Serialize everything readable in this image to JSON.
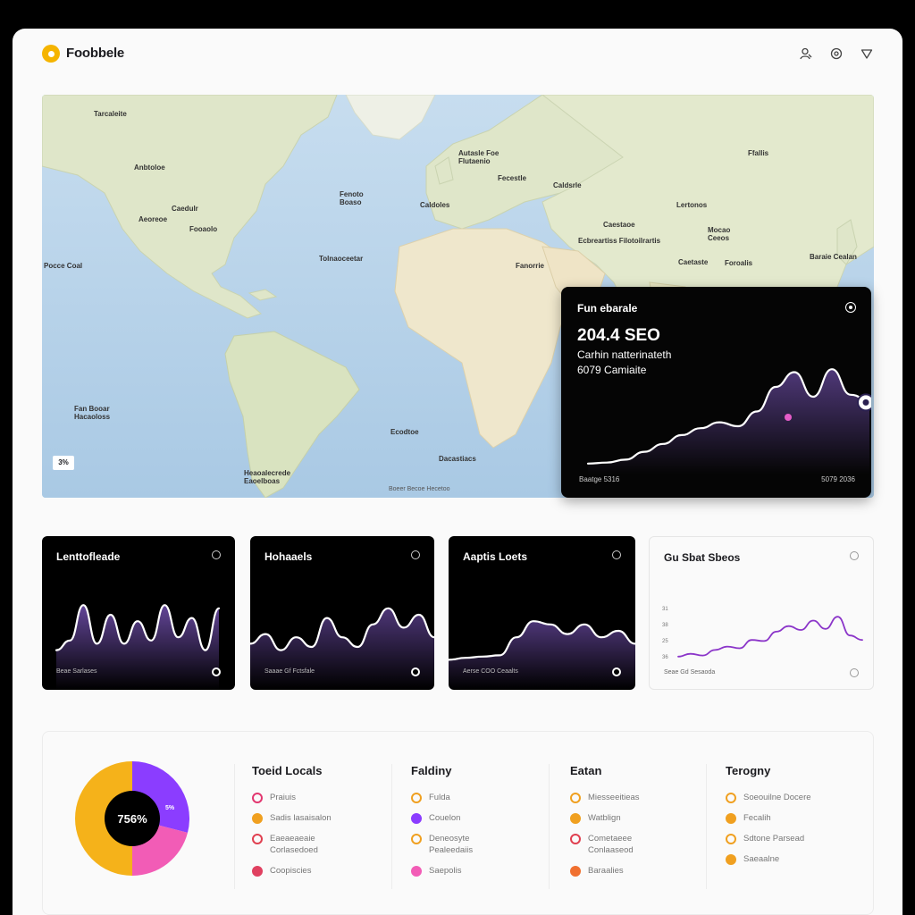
{
  "app": {
    "title": "Foobbele"
  },
  "header_icons": [
    "user-icon",
    "settings-icon",
    "heart-icon"
  ],
  "map": {
    "labels": [
      {
        "text": "Tarcaleite"
      },
      {
        "text": "Anbtoloe"
      },
      {
        "text": "Caedulr"
      },
      {
        "text": "Fooaolo"
      },
      {
        "text": "Pocce Coal"
      },
      {
        "text": "Aeoreoe"
      },
      {
        "text": "Tolnaoceetar"
      },
      {
        "text": "Fenoto Boaso"
      },
      {
        "text": "Caldoles"
      },
      {
        "text": "Autasle Foe Flutaenio"
      },
      {
        "text": "Fecestle"
      },
      {
        "text": "Caldsrle"
      },
      {
        "text": "Ffallis"
      },
      {
        "text": "Lertonos"
      },
      {
        "text": "Caestaoe"
      },
      {
        "text": "Ecbreartiss Filotoilrartis"
      },
      {
        "text": "Mocao Ceeos"
      },
      {
        "text": "Fanorrie"
      },
      {
        "text": "Caetaste"
      },
      {
        "text": "Foroalis"
      },
      {
        "text": "Ecodtoe"
      },
      {
        "text": "Baraie Cealan"
      },
      {
        "text": "Fan Booar Hacaoloss"
      },
      {
        "text": "Dacastiacs"
      },
      {
        "text": "Heaoalecrede Eaoelboas"
      }
    ],
    "scale_label": "3%",
    "attribution": "Boeer Becoe Hecetoo"
  },
  "popup": {
    "title": "Fun ebarale",
    "value": "204.4 SEO",
    "sub1": "Carhin natterinateth",
    "sub2": "6079 Camiaite",
    "foot_left": "Baatge 5316",
    "foot_right": "5079 2036",
    "series": [
      2,
      3,
      6,
      14,
      22,
      31,
      38,
      44,
      40,
      55,
      80,
      95,
      70,
      98,
      72,
      66
    ]
  },
  "cards": [
    {
      "title": "Lenttofleade",
      "footer": "Beae Sarlases",
      "series": [
        20,
        35,
        90,
        30,
        75,
        30,
        65,
        35,
        90,
        40,
        70,
        20,
        85
      ]
    },
    {
      "title": "Hohaaels",
      "footer": "Saaae Gf Fctsfale",
      "series": [
        30,
        45,
        20,
        40,
        25,
        70,
        40,
        25,
        60,
        85,
        55,
        75,
        40
      ]
    },
    {
      "title": "Aaptis Loets",
      "footer": "Aerse COO Ceaalts",
      "series": [
        5,
        8,
        10,
        12,
        40,
        65,
        60,
        45,
        60,
        40,
        50,
        30
      ]
    },
    {
      "title": "Gu Sbat Sbeos",
      "footer": "Seae Gd Sesaoda",
      "y_ticks": [
        "31",
        "38",
        "25",
        "36"
      ],
      "series": [
        10,
        15,
        12,
        22,
        28,
        25,
        40,
        38,
        55,
        65,
        58,
        75,
        60,
        82,
        48,
        40
      ]
    }
  ],
  "donut": {
    "center_label": "756%",
    "slice_label": "5%",
    "slices": [
      {
        "value": 29,
        "color": "#8b3dff"
      },
      {
        "value": 21,
        "color": "#f25cb6"
      },
      {
        "value": 50,
        "color": "#f5b21a"
      }
    ]
  },
  "columns": [
    {
      "title": "Toeid Locals",
      "items": [
        {
          "text": "Praiuis",
          "icon": "flame-icon",
          "color": "#e2366f"
        },
        {
          "text": "Sadis lasaisalon",
          "icon": "cup-icon",
          "color": "#f0a020"
        },
        {
          "text": "Eaeaeaeaie Corlasedoed",
          "icon": "circle-icon",
          "color": "#e04050"
        },
        {
          "text": "Coopiscies",
          "icon": "ring-icon",
          "color": "#e04060"
        }
      ]
    },
    {
      "title": "Faldiny",
      "items": [
        {
          "text": "Fulda",
          "icon": "coin-icon",
          "color": "#f0a020"
        },
        {
          "text": "Couelon",
          "icon": "hand-icon",
          "color": "#8b3dff"
        },
        {
          "text": "Deneosyte Pealeedaiis",
          "icon": "coin-icon",
          "color": "#f0a020"
        },
        {
          "text": "Saepolis",
          "icon": "pill-icon",
          "color": "#f25cb6"
        }
      ]
    },
    {
      "title": "Eatan",
      "items": [
        {
          "text": "Miesseeitieas",
          "icon": "coin-icon",
          "color": "#f0a020"
        },
        {
          "text": "Watblign",
          "icon": "cup-icon",
          "color": "#f0a020"
        },
        {
          "text": "Cometaeee Conlaaseod",
          "icon": "circle-icon",
          "color": "#e04050"
        },
        {
          "text": "Baraalies",
          "icon": "ring-icon",
          "color": "#f07030"
        }
      ]
    },
    {
      "title": "Terogny",
      "items": [
        {
          "text": "Soeouilne Docere",
          "icon": "ring-icon",
          "color": "#f0a020"
        },
        {
          "text": "Fecalih",
          "icon": "figure-icon",
          "color": "#f0a020"
        },
        {
          "text": "Sdtone Parsead",
          "icon": "shield-icon",
          "color": "#f0a020"
        },
        {
          "text": "Saeaalne",
          "icon": "coin-icon",
          "color": "#f0a020"
        }
      ]
    }
  ]
}
